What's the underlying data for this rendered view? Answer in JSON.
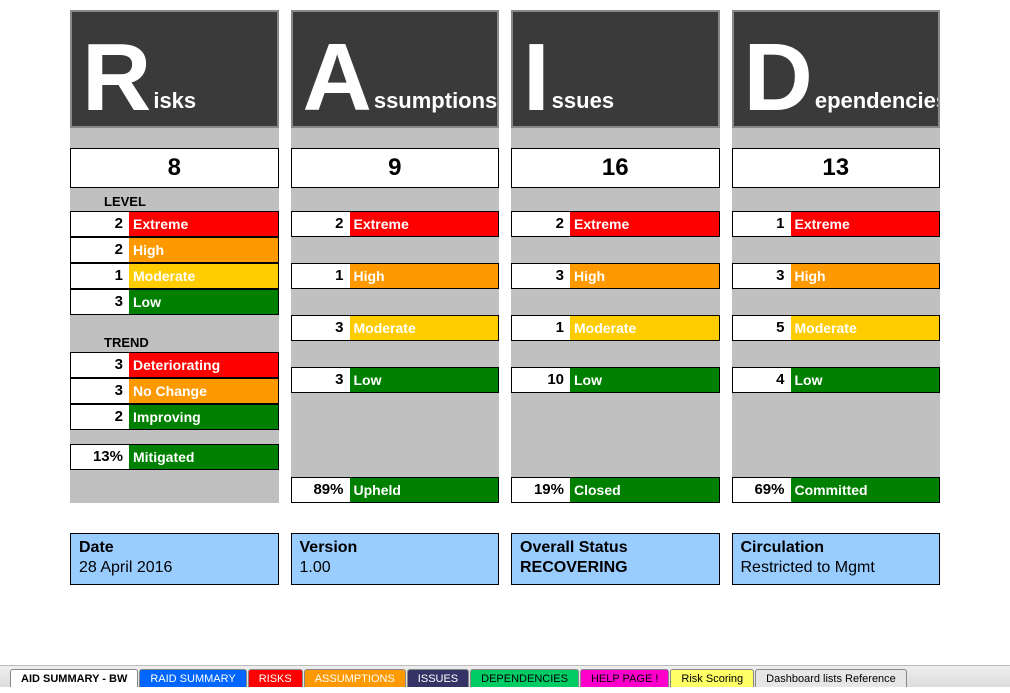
{
  "columns": [
    {
      "letter": "R",
      "suffix": "isks",
      "count": "8",
      "section1_label": "LEVEL",
      "levels": [
        {
          "n": "2",
          "label": "Extreme",
          "cls": "c-extreme"
        },
        {
          "n": "2",
          "label": "High",
          "cls": "c-high"
        },
        {
          "n": "1",
          "label": "Moderate",
          "cls": "c-moderate"
        },
        {
          "n": "3",
          "label": "Low",
          "cls": "c-low"
        }
      ],
      "level_gap": "tight",
      "section2_label": "TREND",
      "trends": [
        {
          "n": "3",
          "label": "Deteriorating",
          "cls": "c-deteriorating"
        },
        {
          "n": "3",
          "label": "No Change",
          "cls": "c-nochange"
        },
        {
          "n": "2",
          "label": "Improving",
          "cls": "c-improving"
        }
      ],
      "status": {
        "pct": "13%",
        "label": "Mitigated"
      }
    },
    {
      "letter": "A",
      "suffix": "ssumptions",
      "count": "9",
      "levels": [
        {
          "n": "2",
          "label": "Extreme",
          "cls": "c-extreme"
        },
        {
          "n": "1",
          "label": "High",
          "cls": "c-high"
        },
        {
          "n": "3",
          "label": "Moderate",
          "cls": "c-moderate"
        },
        {
          "n": "3",
          "label": "Low",
          "cls": "c-low"
        }
      ],
      "level_gap": "wide",
      "status": {
        "pct": "89%",
        "label": "Upheld"
      }
    },
    {
      "letter": "I",
      "suffix": "ssues",
      "count": "16",
      "levels": [
        {
          "n": "2",
          "label": "Extreme",
          "cls": "c-extreme"
        },
        {
          "n": "3",
          "label": "High",
          "cls": "c-high"
        },
        {
          "n": "1",
          "label": "Moderate",
          "cls": "c-moderate"
        },
        {
          "n": "10",
          "label": "Low",
          "cls": "c-low"
        }
      ],
      "level_gap": "wide",
      "status": {
        "pct": "19%",
        "label": "Closed"
      }
    },
    {
      "letter": "D",
      "suffix": "ependencies",
      "count": "13",
      "levels": [
        {
          "n": "1",
          "label": "Extreme",
          "cls": "c-extreme"
        },
        {
          "n": "3",
          "label": "High",
          "cls": "c-high"
        },
        {
          "n": "5",
          "label": "Moderate",
          "cls": "c-moderate"
        },
        {
          "n": "4",
          "label": "Low",
          "cls": "c-low"
        }
      ],
      "level_gap": "wide",
      "status": {
        "pct": "69%",
        "label": "Committed"
      }
    }
  ],
  "meta": [
    {
      "title": "Date",
      "value": "28 April 2016"
    },
    {
      "title": "Version",
      "value": "1.00"
    },
    {
      "title": "Overall Status",
      "value": "RECOVERING",
      "bold_value": true
    },
    {
      "title": "Circulation",
      "value": "Restricted to Mgmt"
    }
  ],
  "tabs": [
    {
      "label": "AID SUMMARY - BW",
      "cls": "tab-active"
    },
    {
      "label": "RAID SUMMARY",
      "cls": "tab-blue"
    },
    {
      "label": "RISKS",
      "cls": "tab-red"
    },
    {
      "label": "ASSUMPTIONS",
      "cls": "tab-orange"
    },
    {
      "label": "ISSUES",
      "cls": "tab-dark"
    },
    {
      "label": "DEPENDENCIES",
      "cls": "tab-green"
    },
    {
      "label": "HELP PAGE !",
      "cls": "tab-magenta"
    },
    {
      "label": "Risk Scoring",
      "cls": "tab-yellow"
    },
    {
      "label": "Dashboard lists Reference",
      "cls": "tab-grey"
    }
  ]
}
